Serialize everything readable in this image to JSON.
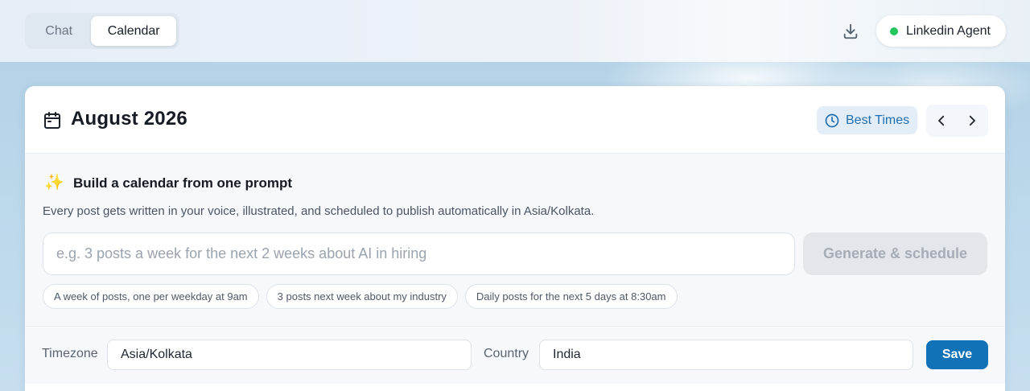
{
  "tabs": [
    {
      "label": "Chat",
      "active": false
    },
    {
      "label": "Calendar",
      "active": true
    }
  ],
  "header": {
    "download_icon": "download-icon",
    "agent": {
      "label": "Linkedin Agent",
      "status_color": "#22c55e"
    }
  },
  "calendar": {
    "icon": "calendar-icon",
    "month_label": "August 2026",
    "best_times_label": "Best Times",
    "best_times_icon": "clock-icon",
    "prev_icon": "chevron-left-icon",
    "next_icon": "chevron-right-icon"
  },
  "builder": {
    "icon": "sparkles-icon",
    "title": "Build a calendar from one prompt",
    "description": "Every post gets written in your voice, illustrated, and scheduled to publish automatically in Asia/Kolkata.",
    "prompt_value": "",
    "prompt_placeholder": "e.g. 3 posts a week for the next 2 weeks about AI in hiring",
    "generate_label": "Generate & schedule",
    "suggestions": [
      "A week of posts, one per weekday at 9am",
      "3 posts next week about my industry",
      "Daily posts for the next 5 days at 8:30am"
    ]
  },
  "settings": {
    "timezone_label": "Timezone",
    "timezone_value": "Asia/Kolkata",
    "country_label": "Country",
    "country_value": "India",
    "save_label": "Save"
  },
  "colors": {
    "accent": "#1172b7",
    "best_times_bg": "#e2edf8",
    "status_online": "#22c55e"
  }
}
